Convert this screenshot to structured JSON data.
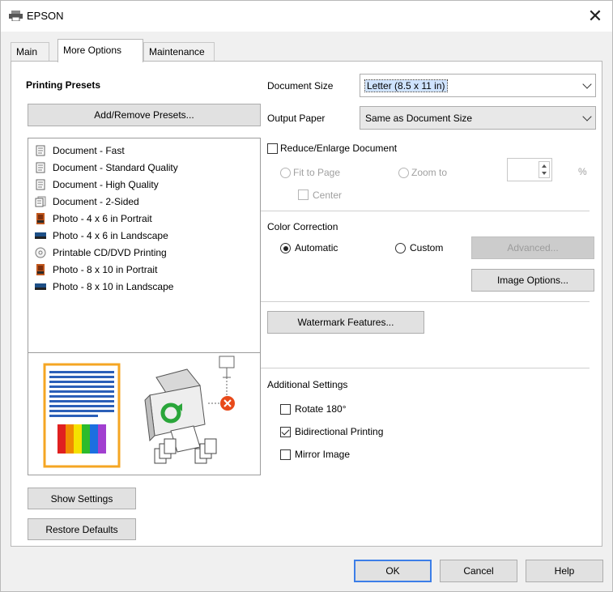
{
  "window": {
    "title": "EPSON"
  },
  "tabs": [
    {
      "label": "Main"
    },
    {
      "label": "More Options"
    },
    {
      "label": "Maintenance"
    }
  ],
  "presets": {
    "heading": "Printing Presets",
    "add_remove_button": "Add/Remove Presets...",
    "items": [
      {
        "label": "Document - Fast",
        "icon": "document-icon"
      },
      {
        "label": "Document - Standard Quality",
        "icon": "document-icon"
      },
      {
        "label": "Document - High Quality",
        "icon": "document-icon"
      },
      {
        "label": "Document - 2-Sided",
        "icon": "two-sided-document-icon"
      },
      {
        "label": "Photo - 4 x 6 in Portrait",
        "icon": "photo-portrait-icon"
      },
      {
        "label": "Photo - 4 x 6 in Landscape",
        "icon": "photo-landscape-icon"
      },
      {
        "label": "Printable CD/DVD Printing",
        "icon": "cd-dvd-icon"
      },
      {
        "label": "Photo - 8 x 10 in Portrait",
        "icon": "photo-portrait-icon"
      },
      {
        "label": "Photo - 8 x 10 in Landscape",
        "icon": "photo-landscape-icon"
      }
    ]
  },
  "document_size": {
    "label": "Document Size",
    "value": "Letter (8.5 x 11 in)"
  },
  "output_paper": {
    "label": "Output Paper",
    "value": "Same as Document Size"
  },
  "reduce_enlarge": {
    "label": "Reduce/Enlarge Document",
    "checked": false,
    "fit_to_page": "Fit to Page",
    "zoom_to": "Zoom to",
    "percent": "%",
    "center": "Center"
  },
  "color_correction": {
    "label": "Color Correction",
    "automatic": "Automatic",
    "custom": "Custom",
    "selected": "Automatic",
    "advanced_button": "Advanced...",
    "image_options_button": "Image Options..."
  },
  "watermark_button": "Watermark Features...",
  "additional_settings": {
    "label": "Additional Settings",
    "rotate_180": {
      "label": "Rotate 180°",
      "checked": false
    },
    "bidirectional": {
      "label": "Bidirectional Printing",
      "checked": true
    },
    "mirror_image": {
      "label": "Mirror Image",
      "checked": false
    }
  },
  "left_buttons": {
    "show_settings": "Show Settings",
    "restore_defaults": "Restore Defaults"
  },
  "dialog_buttons": {
    "ok": "OK",
    "cancel": "Cancel",
    "help": "Help"
  },
  "colors": {
    "accent": "#3c7ee8",
    "error": "#e84a1a"
  }
}
